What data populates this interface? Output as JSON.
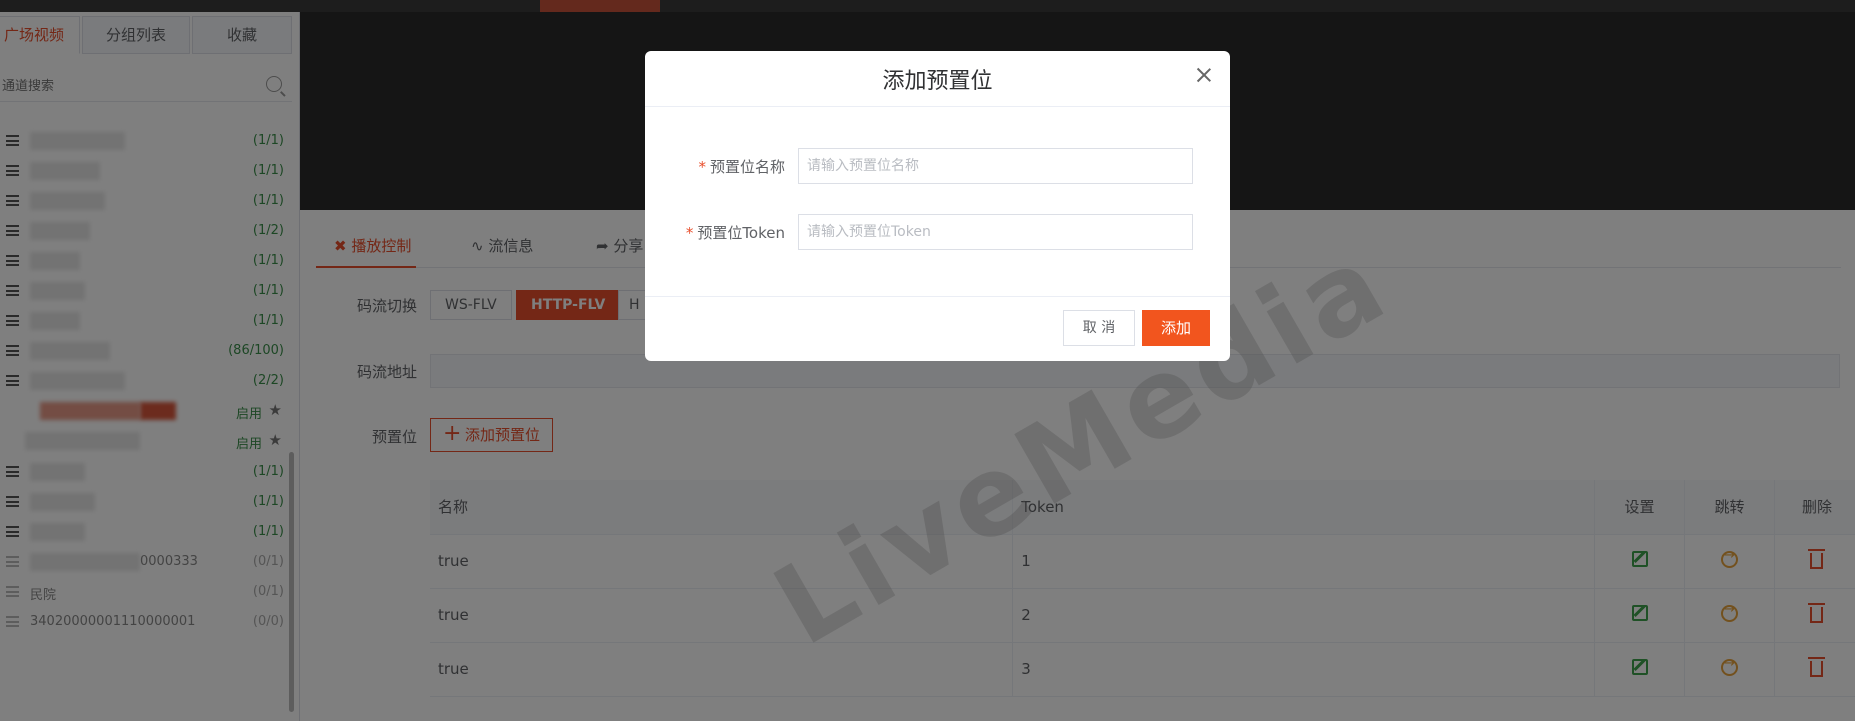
{
  "sidebar": {
    "tabs": [
      {
        "label": "广场视频",
        "active": true
      },
      {
        "label": "分组列表",
        "active": false
      },
      {
        "label": "收藏",
        "active": false
      }
    ],
    "search_placeholder": "通道搜索",
    "tree": [
      {
        "count": "(1/1)"
      },
      {
        "count": "(1/1)"
      },
      {
        "count": "(1/1)"
      },
      {
        "count": "(1/2)"
      },
      {
        "count": "(1/1)"
      },
      {
        "count": "(1/1)"
      },
      {
        "count": "(1/1)"
      },
      {
        "count": "(86/100)"
      },
      {
        "count": "(2/2)"
      },
      {
        "status": "启用"
      },
      {
        "status": "启用"
      },
      {
        "count": "(1/1)"
      },
      {
        "count": "(1/1)"
      },
      {
        "count": "(1/1)"
      },
      {
        "label": "0000333",
        "count": "(0/1)"
      },
      {
        "label": "民院",
        "count": "(0/1)"
      },
      {
        "label": "34020000001110000001",
        "count": "(0/0)"
      }
    ]
  },
  "player": {
    "tabs": [
      {
        "label": "播放控制",
        "icon": "tools-icon",
        "active": true
      },
      {
        "label": "流信息",
        "icon": "pulse-icon",
        "active": false
      },
      {
        "label": "分享",
        "icon": "share-icon",
        "active": false
      }
    ],
    "stream_switch_label": "码流切换",
    "stream_options": [
      "WS-FLV",
      "HTTP-FLV",
      "H"
    ],
    "stream_selected": "HTTP-FLV",
    "stream_address_label": "码流地址",
    "preset_label": "预置位",
    "add_preset_button": "添加预置位",
    "table": {
      "headers": [
        "名称",
        "Token",
        "设置",
        "跳转",
        "删除"
      ],
      "rows": [
        {
          "name": "true",
          "token": "1"
        },
        {
          "name": "true",
          "token": "2"
        },
        {
          "name": "true",
          "token": "3"
        }
      ]
    },
    "watermark": "LiveMedia"
  },
  "dialog": {
    "title": "添加预置位",
    "fields": [
      {
        "label": "预置位名称",
        "placeholder": "请输入预置位名称",
        "required": true
      },
      {
        "label": "预置位Token",
        "placeholder": "请输入预置位Token",
        "required": true
      }
    ],
    "cancel_label": "取 消",
    "confirm_label": "添加"
  },
  "colors": {
    "accent": "#e84e2c",
    "success": "#3fa34d",
    "warning": "#e6a23c"
  }
}
